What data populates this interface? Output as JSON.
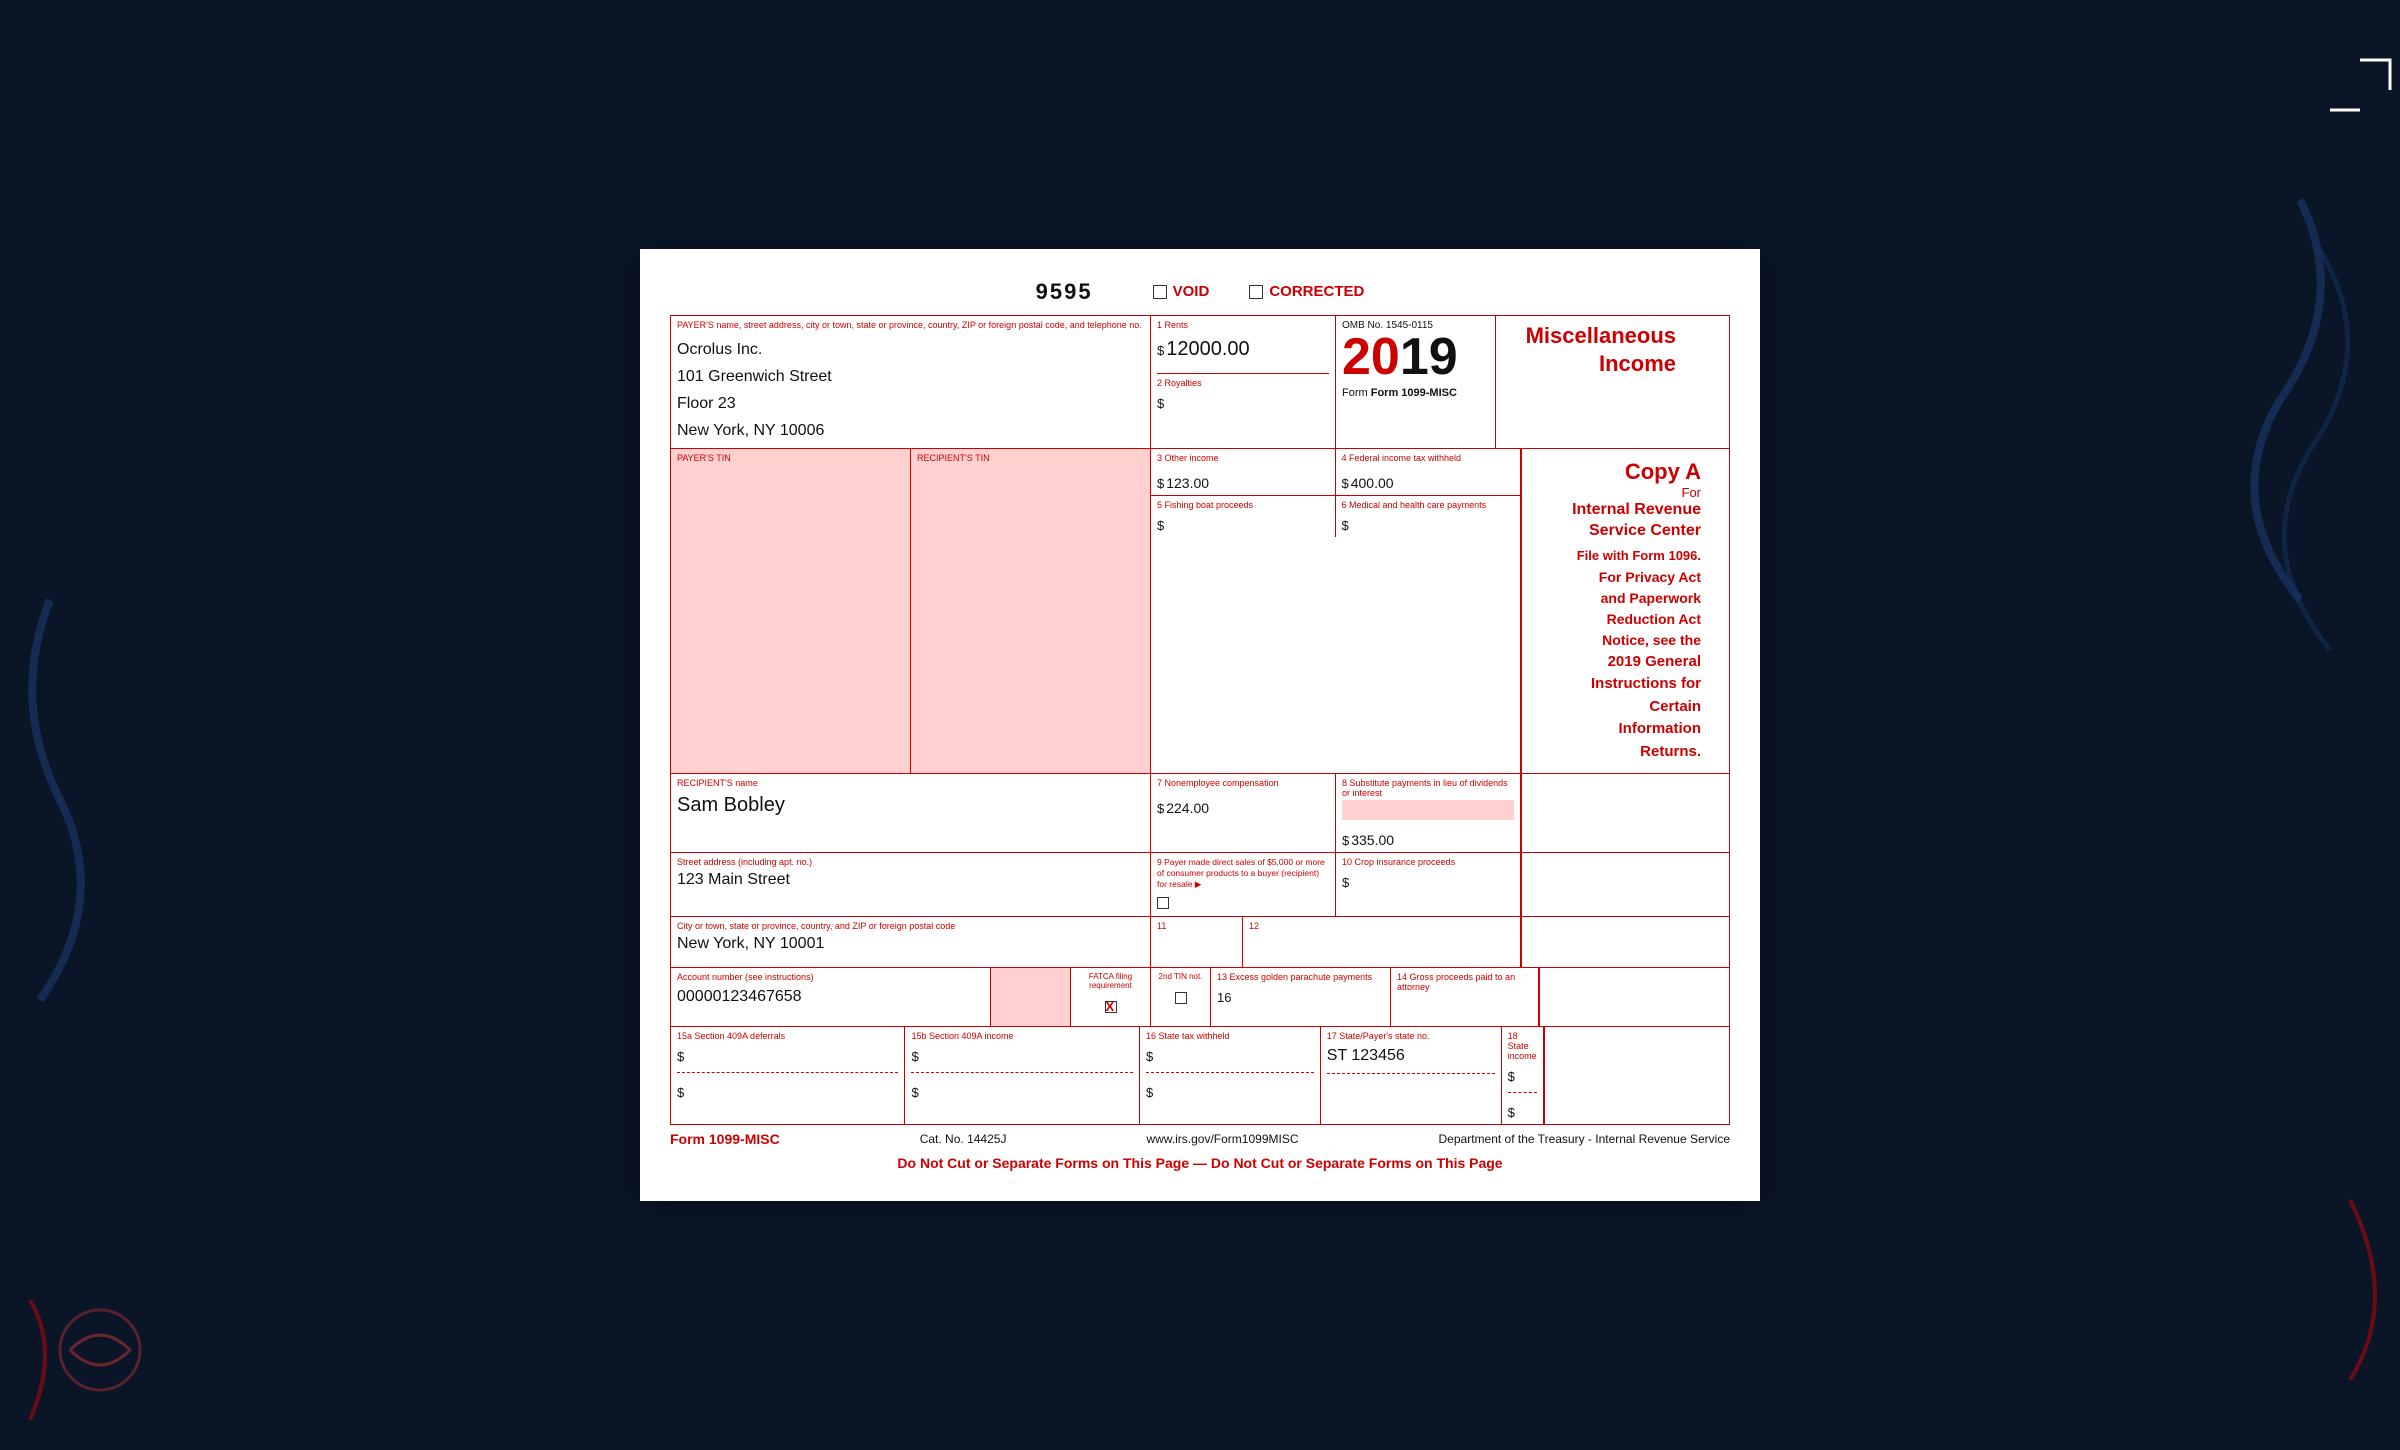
{
  "form": {
    "number": "9595",
    "void_label": "VOID",
    "corrected_label": "CORRECTED",
    "title": "Miscellaneous Income",
    "copy_a_label": "Copy A",
    "copy_a_for": "For",
    "irs_center": "Internal Revenue Service Center",
    "file_with": "File with Form 1096.",
    "privacy_text1": "For Privacy Act",
    "privacy_text2": "and Paperwork",
    "privacy_text3": "Reduction Act",
    "privacy_text4": "Notice, see the",
    "privacy_text5_bold": "2019 General",
    "privacy_text6_bold": "Instructions for",
    "privacy_text7_bold": "Certain",
    "privacy_text8_bold": "Information",
    "privacy_text9_bold": "Returns.",
    "omb_number": "OMB No. 1545-0115",
    "year": "20",
    "year2": "19",
    "form_label": "Form 1099-MISC",
    "payer_name_label": "PAYER'S name, street address, city or town, state or province, country, ZIP or foreign postal code, and telephone no.",
    "payer_name": "Ocrolus Inc.",
    "payer_street": "101 Greenwich Street",
    "payer_floor": "Floor 23",
    "payer_city": "New York, NY 10006",
    "box1_label": "1 Rents",
    "box1_value": "12000.00",
    "box2_label": "2 Royalties",
    "box2_value": "",
    "box3_label": "3 Other income",
    "box3_value": "123.00",
    "box4_label": "4 Federal income tax withheld",
    "box4_value": "400.00",
    "payer_tin_label": "PAYER'S TIN",
    "recipient_tin_label": "RECIPIENT'S TIN",
    "box5_label": "5 Fishing boat proceeds",
    "box5_value": "",
    "box6_label": "6 Medical and health care payments",
    "box6_value": "",
    "recipient_name_label": "RECIPIENT'S name",
    "recipient_name": "Sam Bobley",
    "box7_label": "7 Nonemployee compensation",
    "box7_value": "224.00",
    "box8_label": "8 Substitute payments in lieu of dividends or interest",
    "box8_value": "335.00",
    "street_label": "Street address (including apt. no.)",
    "street_value": "123 Main Street",
    "box9_label": "9 Payer made direct sales of $5,000 or more of consumer products to a buyer (recipient) for resale ▶",
    "box9_checked": false,
    "box10_label": "10 Crop insurance proceeds",
    "box10_value": "",
    "city_label": "City or town, state or province, country, and ZIP or foreign postal code",
    "city_value": "New York, NY 10001",
    "box11_label": "11",
    "box12_label": "12",
    "account_label": "Account number (see instructions)",
    "account_value": "00000123467658",
    "fatca_label": "FATCA filing requirement",
    "fatca_checked": true,
    "tin2nd_label": "2nd TIN not.",
    "tin2nd_checked": false,
    "box13_label": "13 Excess golden parachute payments",
    "box13_value": "",
    "box14_label": "14 Gross proceeds paid to an attorney",
    "box14_value": "",
    "box16_label": "16",
    "box15a_label": "15a Section 409A deferrals",
    "box15a_value": "",
    "box15b_label": "15b Section 409A income",
    "box15b_value": "",
    "box16_state_label": "16 State tax withheld",
    "box16_value": "",
    "box17_label": "17 State/Payer's state no.",
    "box17_value": "ST 123456",
    "box18_label": "18 State income",
    "box18_value": "",
    "footer_form": "Form 1099-MISC",
    "footer_cat": "Cat. No. 14425J",
    "footer_website": "www.irs.gov/Form1099MISC",
    "footer_dept": "Department of the Treasury - Internal Revenue Service",
    "do_not_cut": "Do Not Cut or Separate Forms on This Page — Do Not Cut or Separate Forms on This Page"
  }
}
